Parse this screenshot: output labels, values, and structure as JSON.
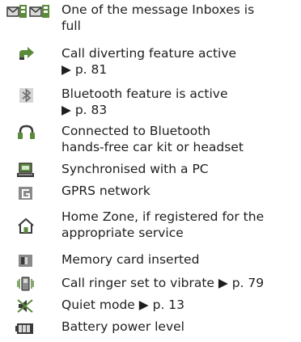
{
  "icon_list": [
    {
      "icon": "message-inbox-full-icon",
      "description": "One of the message Inboxes is\nfull"
    },
    {
      "icon": "call-diverting-icon",
      "description": "Call diverting feature active\n▶ p. 81"
    },
    {
      "icon": "bluetooth-icon",
      "description": "Bluetooth feature is active\n▶ p. 83"
    },
    {
      "icon": "headset-icon",
      "description": "Connected to Bluetooth\nhands-free car kit or headset"
    },
    {
      "icon": "pc-sync-icon",
      "description": "Synchronised with a PC"
    },
    {
      "icon": "gprs-icon",
      "description": "GPRS network"
    },
    {
      "icon": "home-zone-icon",
      "description": "Home Zone, if registered for the\nappropriate service"
    },
    {
      "icon": "memory-card-icon",
      "description": "Memory card inserted"
    },
    {
      "icon": "vibrate-icon",
      "description": "Call ringer set to vibrate ▶ p. 79"
    },
    {
      "icon": "quiet-mode-icon",
      "description": "Quiet mode ▶ p. 13"
    },
    {
      "icon": "battery-icon",
      "description": "Battery power level"
    }
  ],
  "colors": {
    "icon_green": "#5a8a3a",
    "icon_dark": "#3a3a3a",
    "icon_gray": "#8a8a8a",
    "text": "#1e1e1e"
  }
}
